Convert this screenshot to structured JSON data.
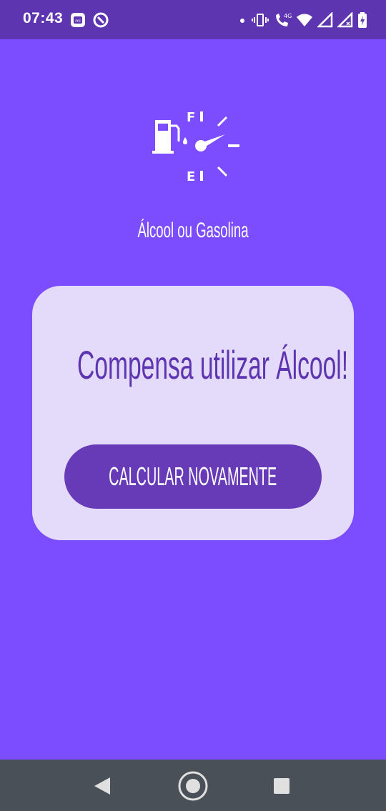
{
  "status_bar": {
    "time": "07:43",
    "left_icons": [
      "mi-icon",
      "vpn-icon"
    ],
    "right_icons": [
      "dot-icon",
      "vibrate-icon",
      "volte-call-icon",
      "wifi-icon",
      "signal-icon",
      "signal-no-data-icon",
      "battery-charging-icon"
    ],
    "network_label": "4G",
    "background": "#5e35b1"
  },
  "header": {
    "logo_icon": "fuel-gauge-icon",
    "gauge_full_label": "F",
    "gauge_empty_label": "E",
    "title": "Álcool ou Gasolina"
  },
  "result": {
    "message": "Compensa utilizar Álcool!",
    "button_label": "CALCULAR NOVAMENTE",
    "card_color": "#e4daf9",
    "button_color": "#673ab7"
  },
  "nav_bar": {
    "back_icon": "back-triangle-icon",
    "home_icon": "home-circle-icon",
    "recents_icon": "recents-square-icon"
  },
  "colors": {
    "background": "#7c4dff",
    "accent_text": "#5e35b1"
  }
}
